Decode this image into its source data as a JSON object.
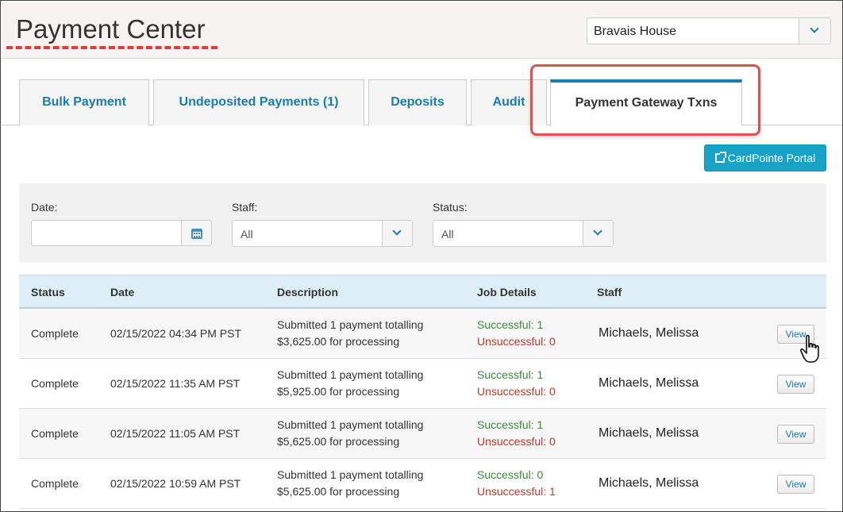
{
  "header": {
    "title": "Payment Center",
    "org_select": {
      "value": "Bravais House"
    }
  },
  "tabs": [
    {
      "label": "Bulk Payment"
    },
    {
      "label": "Undeposited Payments (1)"
    },
    {
      "label": "Deposits"
    },
    {
      "label": "Audit"
    },
    {
      "label": "Payment Gateway Txns"
    }
  ],
  "portal_button": {
    "label": "CardPointe Portal"
  },
  "filters": {
    "date": {
      "label": "Date:",
      "value": ""
    },
    "staff": {
      "label": "Staff:",
      "value": "All"
    },
    "status": {
      "label": "Status:",
      "value": "All"
    }
  },
  "table": {
    "columns": {
      "status": "Status",
      "date": "Date",
      "description": "Description",
      "job_details": "Job Details",
      "staff": "Staff"
    },
    "rows": [
      {
        "status": "Complete",
        "date": "02/15/2022 04:34 PM PST",
        "desc1": "Submitted 1 payment totalling",
        "desc2": "$3,625.00 for processing",
        "success": "Successful: 1",
        "fail": "Unsuccessful: 0",
        "staff": "Michaels, Melissa",
        "action": "View"
      },
      {
        "status": "Complete",
        "date": "02/15/2022 11:35 AM PST",
        "desc1": "Submitted 1 payment totalling",
        "desc2": "$5,925.00 for processing",
        "success": "Successful: 1",
        "fail": "Unsuccessful: 0",
        "staff": "Michaels, Melissa",
        "action": "View"
      },
      {
        "status": "Complete",
        "date": "02/15/2022 11:05 AM PST",
        "desc1": "Submitted 1 payment totalling",
        "desc2": "$5,625.00 for processing",
        "success": "Successful: 1",
        "fail": "Unsuccessful: 0",
        "staff": "Michaels, Melissa",
        "action": "View"
      },
      {
        "status": "Complete",
        "date": "02/15/2022 10:59 AM PST",
        "desc1": "Submitted 1 payment totalling",
        "desc2": "$5,625.00 for processing",
        "success": "Successful: 0",
        "fail": "Unsuccessful: 1",
        "staff": "Michaels, Melissa",
        "action": "View"
      }
    ]
  },
  "colors": {
    "accent": "#1a7ca8",
    "highlight": "#e05050",
    "success": "#3c8a3c",
    "fail": "#c0392b",
    "portal": "#17a2c8"
  }
}
